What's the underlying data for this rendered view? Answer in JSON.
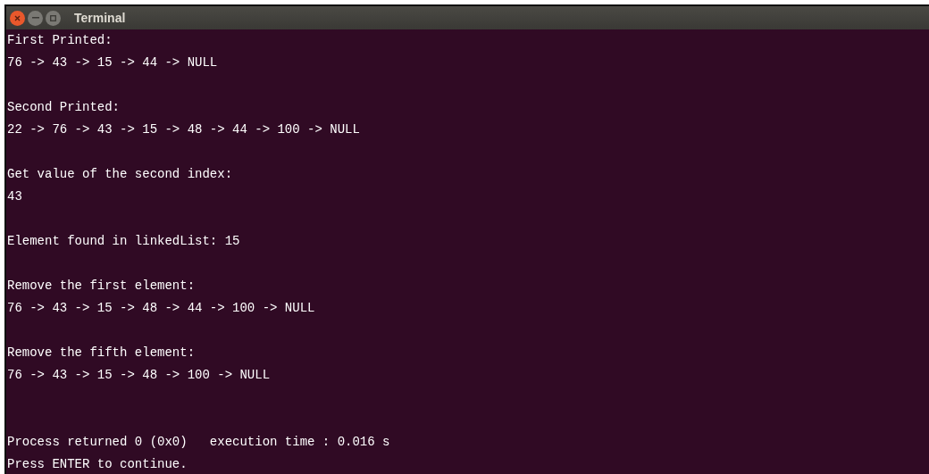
{
  "window": {
    "title": "Terminal"
  },
  "blocks": [
    {
      "kind": "output",
      "lines": [
        "First Printed:",
        "76 -> 43 -> 15 -> 44 -> NULL"
      ]
    },
    {
      "kind": "output",
      "lines": [
        "Second Printed:",
        "22 -> 76 -> 43 -> 15 -> 48 -> 44 -> 100 -> NULL"
      ]
    },
    {
      "kind": "output",
      "lines": [
        "Get value of the second index:",
        "43"
      ]
    },
    {
      "kind": "output",
      "lines": [
        "Element found in linkedList: 15"
      ]
    },
    {
      "kind": "output",
      "lines": [
        "Remove the first element:",
        "76 -> 43 -> 15 -> 48 -> 44 -> 100 -> NULL"
      ]
    },
    {
      "kind": "output",
      "lines": [
        "Remove the fifth element:",
        "76 -> 43 -> 15 -> 48 -> 100 -> NULL"
      ]
    },
    {
      "kind": "status",
      "lines": [
        "Process returned 0 (0x0)   execution time : 0.016 s",
        "Press ENTER to continue."
      ]
    }
  ]
}
